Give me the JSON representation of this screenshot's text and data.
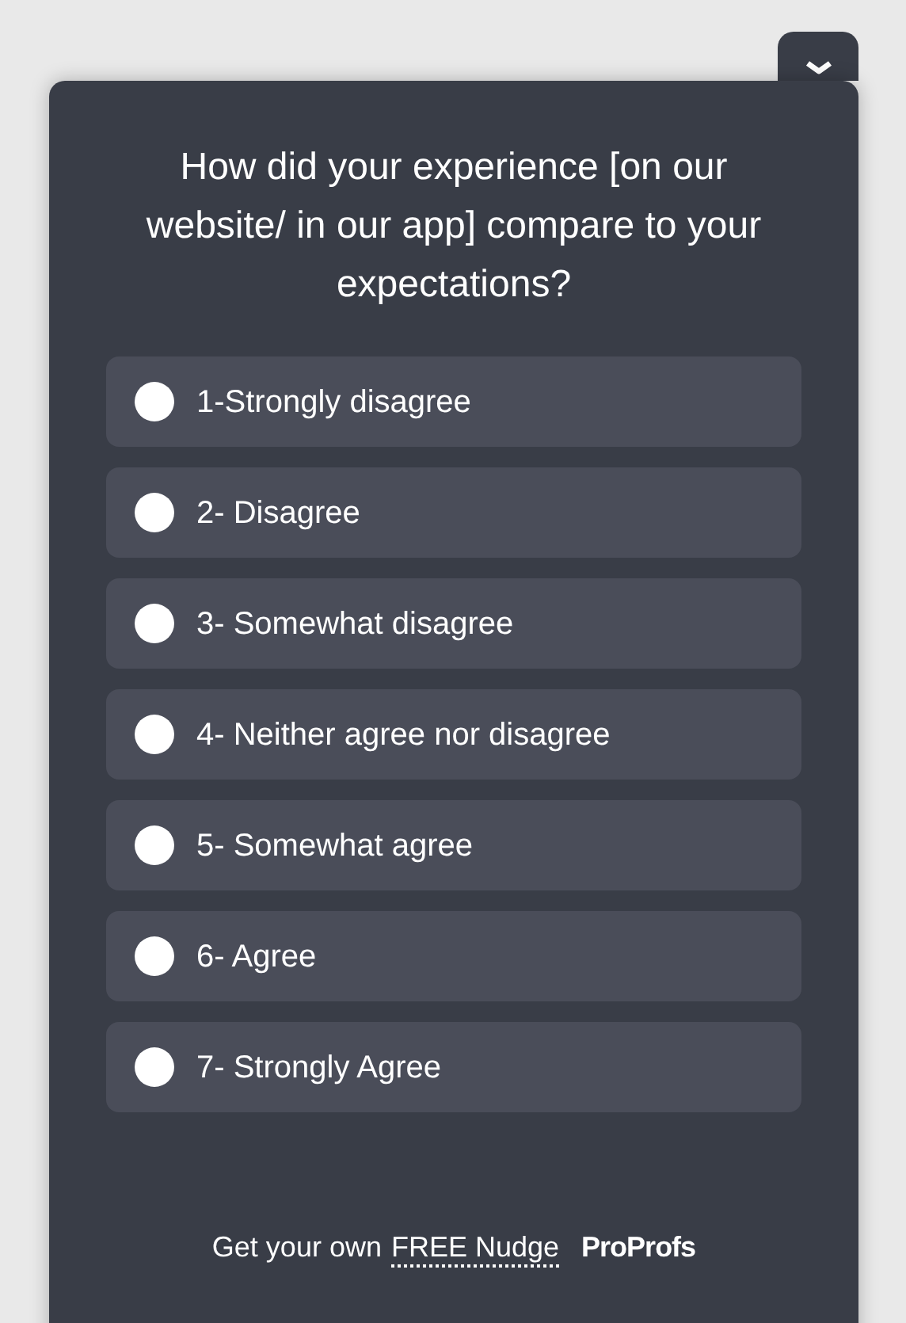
{
  "question": "How did your experience [on our website/ in our app] compare to your expectations?",
  "options": [
    {
      "label": "1-Strongly disagree",
      "selected": false
    },
    {
      "label": "2- Disagree",
      "selected": false
    },
    {
      "label": "3- Somewhat disagree",
      "selected": false
    },
    {
      "label": "4- Neither agree nor disagree",
      "selected": false
    },
    {
      "label": "5- Somewhat agree",
      "selected": false
    },
    {
      "label": "6- Agree",
      "selected": false
    },
    {
      "label": "7- Strongly Agree",
      "selected": false
    }
  ],
  "footer": {
    "text": "Get your own",
    "link": "FREE Nudge",
    "brand": "ProProfs"
  }
}
